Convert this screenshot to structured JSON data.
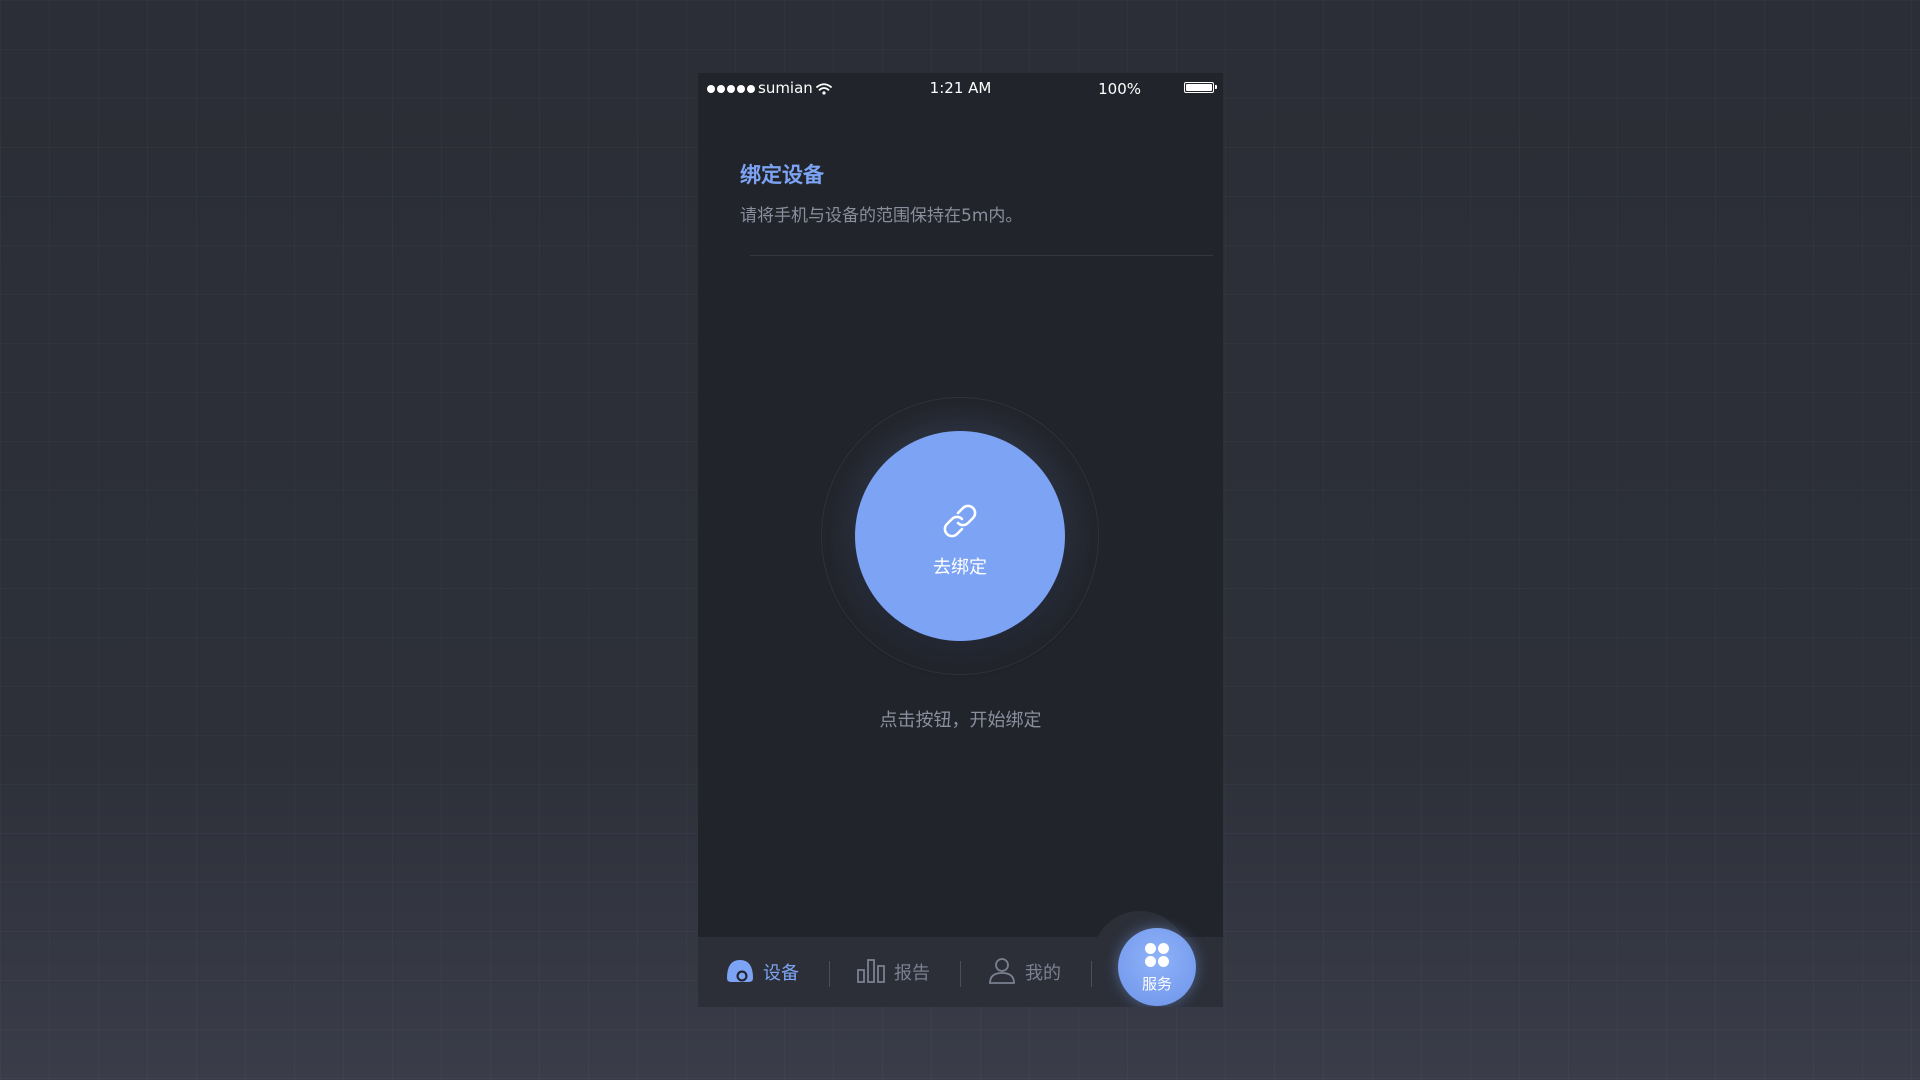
{
  "status_bar": {
    "carrier": "sumian",
    "time": "1:21 AM",
    "battery_percent": "100%",
    "signal_bars": 5,
    "battery_level": 1.0
  },
  "header": {
    "title": "绑定设备",
    "subtitle": "请将手机与设备的范围保持在5m内。"
  },
  "bind": {
    "button_label": "去绑定",
    "hint": "点击按钮，开始绑定",
    "icon": "link-icon"
  },
  "tab_bar": {
    "tabs": [
      {
        "label": "设备",
        "icon": "device-icon",
        "active": true
      },
      {
        "label": "报告",
        "icon": "bar-chart-icon",
        "active": false
      },
      {
        "label": "我的",
        "icon": "user-icon",
        "active": false
      }
    ],
    "fab": {
      "label": "服务",
      "icon": "grid-icon"
    }
  },
  "colors": {
    "accent": "#7ca3f4",
    "screen_bg": "#22242b",
    "tab_bar_bg": "#2c2f38",
    "muted_text": "#8a8f9e"
  }
}
